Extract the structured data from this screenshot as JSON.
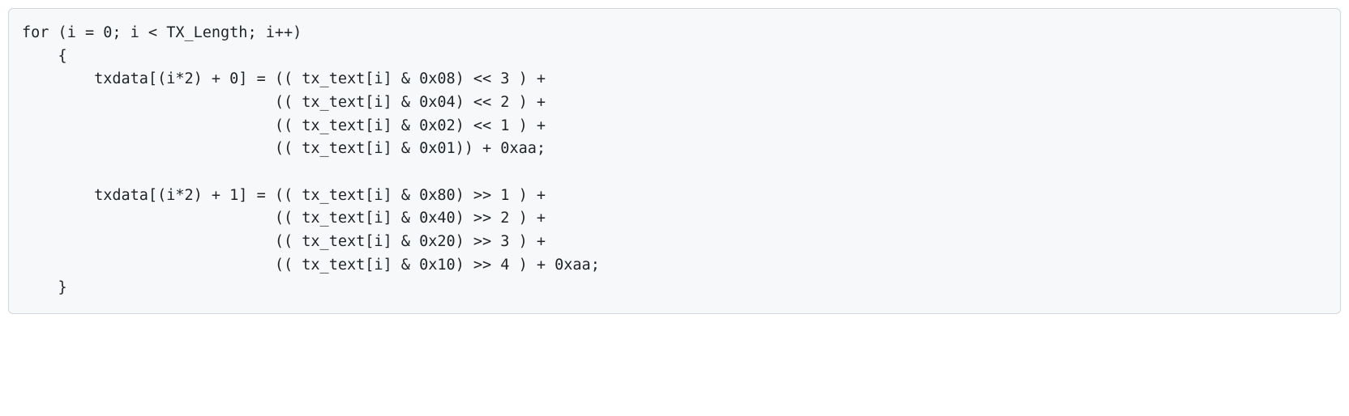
{
  "code": {
    "lines": [
      "for (i = 0; i < TX_Length; i++)",
      "    {",
      "        txdata[(i*2) + 0] = (( tx_text[i] & 0x08) << 3 ) +",
      "                            (( tx_text[i] & 0x04) << 2 ) +",
      "                            (( tx_text[i] & 0x02) << 1 ) +",
      "                            (( tx_text[i] & 0x01)) + 0xaa;",
      "",
      "        txdata[(i*2) + 1] = (( tx_text[i] & 0x80) >> 1 ) +",
      "                            (( tx_text[i] & 0x40) >> 2 ) +",
      "                            (( tx_text[i] & 0x20) >> 3 ) +",
      "                            (( tx_text[i] & 0x10) >> 4 ) + 0xaa;",
      "    }"
    ]
  }
}
